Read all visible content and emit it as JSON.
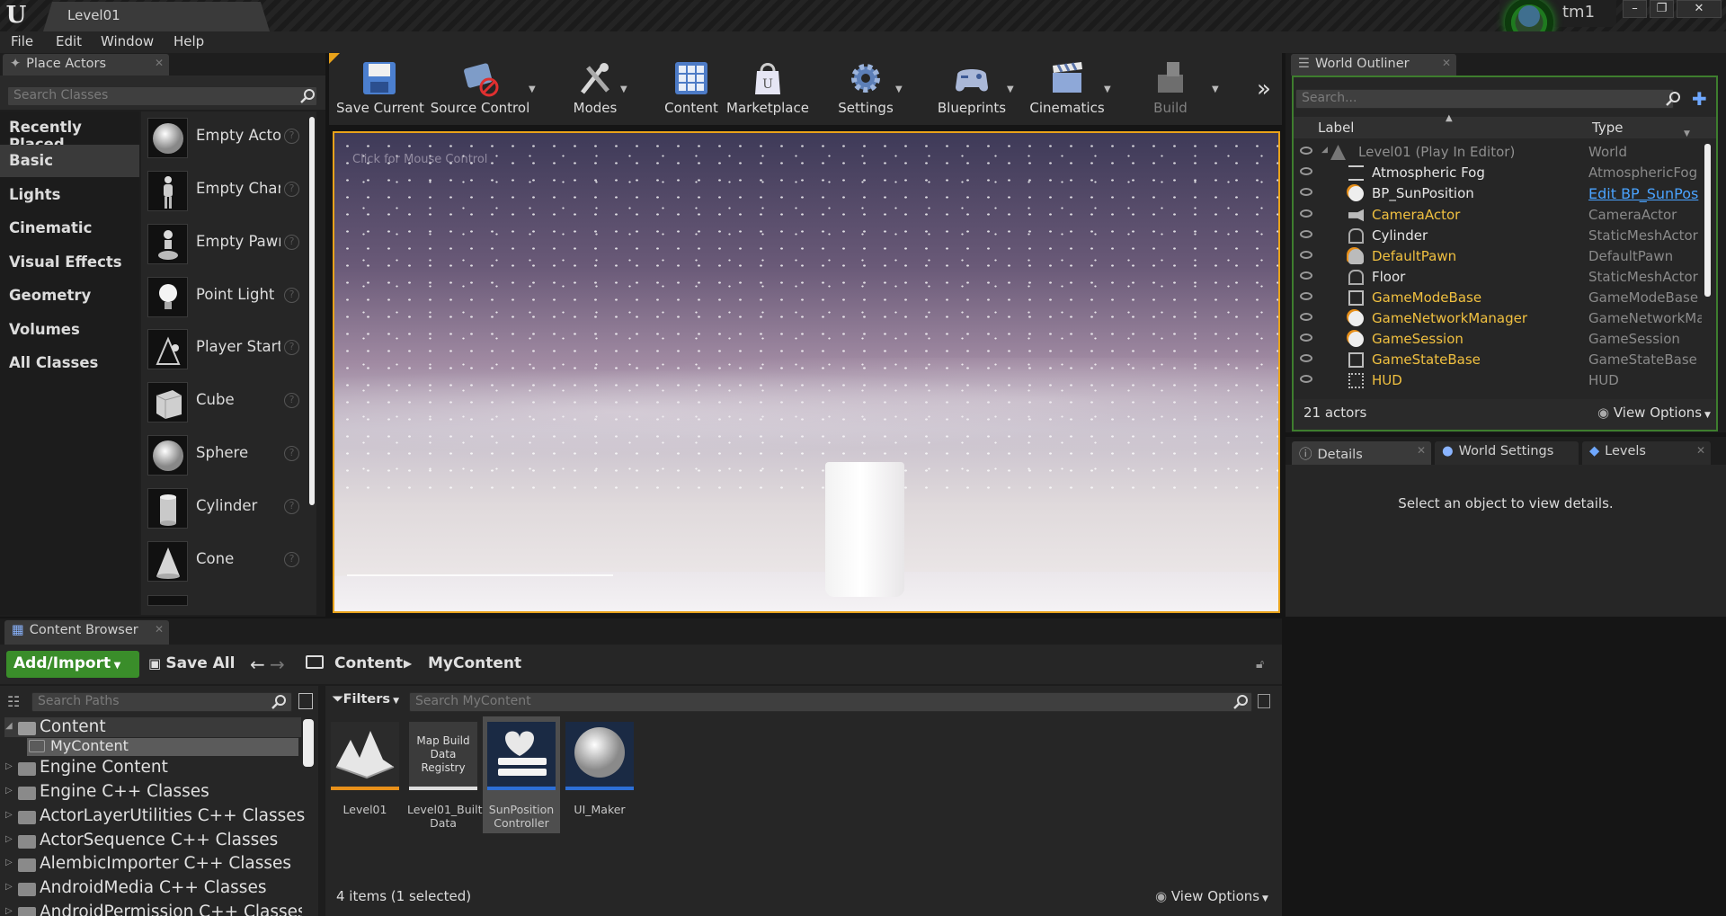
{
  "window": {
    "tab_title": "Level01",
    "user": "tm1",
    "controls": [
      "–",
      "❐",
      "✕"
    ]
  },
  "menu": [
    "File",
    "Edit",
    "Window",
    "Help"
  ],
  "place_actors": {
    "tab": "Place Actors",
    "search_placeholder": "Search Classes",
    "categories": [
      "Recently Placed",
      "Basic",
      "Lights",
      "Cinematic",
      "Visual Effects",
      "Geometry",
      "Volumes",
      "All Classes"
    ],
    "selected_category": "Basic",
    "items": [
      "Empty Acto",
      "Empty Char",
      "Empty Pawı",
      "Point Light",
      "Player Start",
      "Cube",
      "Sphere",
      "Cylinder",
      "Cone"
    ]
  },
  "toolbar": {
    "buttons": [
      "Save Current",
      "Source Control",
      "Modes",
      "Content",
      "Marketplace",
      "Settings",
      "Blueprints",
      "Cinematics",
      "Build"
    ],
    "overflow": "»"
  },
  "viewport": {
    "hint": "Click for Mouse Control"
  },
  "world_outliner": {
    "tab": "World Outliner",
    "search_placeholder": "Search...",
    "col_label": "Label",
    "col_type": "Type",
    "rows": [
      {
        "label": "Level01 (Play In Editor)",
        "type": "World"
      },
      {
        "label": "Atmospheric Fog",
        "type": "AtmosphericFog"
      },
      {
        "label": "BP_SunPosition",
        "type": "Edit BP_SunPos"
      },
      {
        "label": "CameraActor",
        "type": "CameraActor"
      },
      {
        "label": "Cylinder",
        "type": "StaticMeshActor"
      },
      {
        "label": "DefaultPawn",
        "type": "DefaultPawn"
      },
      {
        "label": "Floor",
        "type": "StaticMeshActor"
      },
      {
        "label": "GameModeBase",
        "type": "GameModeBase"
      },
      {
        "label": "GameNetworkManager",
        "type": "GameNetworkMar"
      },
      {
        "label": "GameSession",
        "type": "GameSession"
      },
      {
        "label": "GameStateBase",
        "type": "GameStateBase"
      },
      {
        "label": "HUD",
        "type": "HUD"
      }
    ],
    "actor_count": "21 actors",
    "view_options": "View Options"
  },
  "details": {
    "tabs": [
      "Details",
      "World Settings",
      "Levels"
    ],
    "empty_message": "Select an object to view details."
  },
  "content_browser": {
    "tab": "Content Browser",
    "add_import": "Add/Import",
    "save_all": "Save All",
    "breadcrumb": [
      "Content",
      "MyContent"
    ],
    "search_paths_placeholder": "Search Paths",
    "filters": "Filters",
    "search_content_placeholder": "Search MyContent",
    "tree": [
      {
        "name": "Content",
        "level": 0,
        "expanded": true
      },
      {
        "name": "MyContent",
        "level": 1,
        "selected": true
      },
      {
        "name": "Engine Content",
        "level": 0
      },
      {
        "name": "Engine C++ Classes",
        "level": 0
      },
      {
        "name": "ActorLayerUtilities C++ Classes",
        "level": 0
      },
      {
        "name": "ActorSequence C++ Classes",
        "level": 0
      },
      {
        "name": "AlembicImporter C++ Classes",
        "level": 0
      },
      {
        "name": "AndroidMedia C++ Classes",
        "level": 0
      },
      {
        "name": "AndroidPermission C++ Classes",
        "level": 0
      }
    ],
    "assets": [
      {
        "name": "Level01",
        "thumb_text": "",
        "bar_color": "#e8901a"
      },
      {
        "name": "Level01_Built Data",
        "thumb_text": "Map Build Data Registry",
        "bar_color": "#dddddd"
      },
      {
        "name": "SunPosition Controller",
        "thumb_text": "",
        "bar_color": "#2d6fd6"
      },
      {
        "name": "UI_Maker",
        "thumb_text": "",
        "bar_color": "#2d6fd6"
      }
    ],
    "status": "4 items (1 selected)",
    "view_options": "View Options"
  },
  "colors": {
    "accent_orange": "#e8a21a",
    "outliner_green": "#3e7d2e",
    "add_import_green": "#3a8d2a",
    "link_blue": "#4aa3ff"
  }
}
